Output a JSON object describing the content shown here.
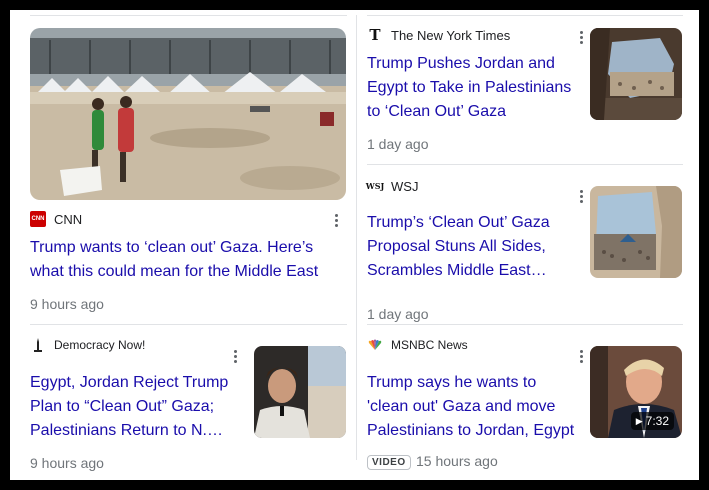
{
  "articles": [
    {
      "source": "CNN",
      "logo_color": "#cc0000",
      "logo_text": "CNN",
      "title": "Trump wants to ‘clean out’ Gaza. Here’s what this could mean for the Middle East",
      "time": "9 hours ago"
    },
    {
      "source": "The New York Times",
      "logo_text": "T",
      "title_lines": [
        "Trump Pushes Jordan and",
        "Egypt to Take in Palestinians",
        "to ‘Clean Out’ Gaza"
      ],
      "time": "1 day ago"
    },
    {
      "source": "WSJ",
      "logo_text": "WSJ",
      "title_lines": [
        "Trump’s ‘Clean Out’ Gaza",
        "Proposal Stuns All Sides,",
        "Scrambles Middle East…"
      ],
      "time": "1 day ago"
    },
    {
      "source": "Democracy Now!",
      "title_lines": [
        "Egypt, Jordan Reject Trump",
        "Plan to “Clean Out” Gaza;",
        "Palestinians Return to N.…"
      ],
      "time": "9 hours ago"
    },
    {
      "source": "MSNBC News",
      "title_lines": [
        "Trump says he wants to",
        "'clean out' Gaza and move",
        "Palestinians to Jordan, Egypt"
      ],
      "badge": "VIDEO",
      "time": "15 hours ago",
      "duration": "7:32"
    }
  ],
  "icons": [
    "more-options-icon",
    "play-icon",
    "nbc-peacock-icon",
    "liberty-torch-icon"
  ]
}
